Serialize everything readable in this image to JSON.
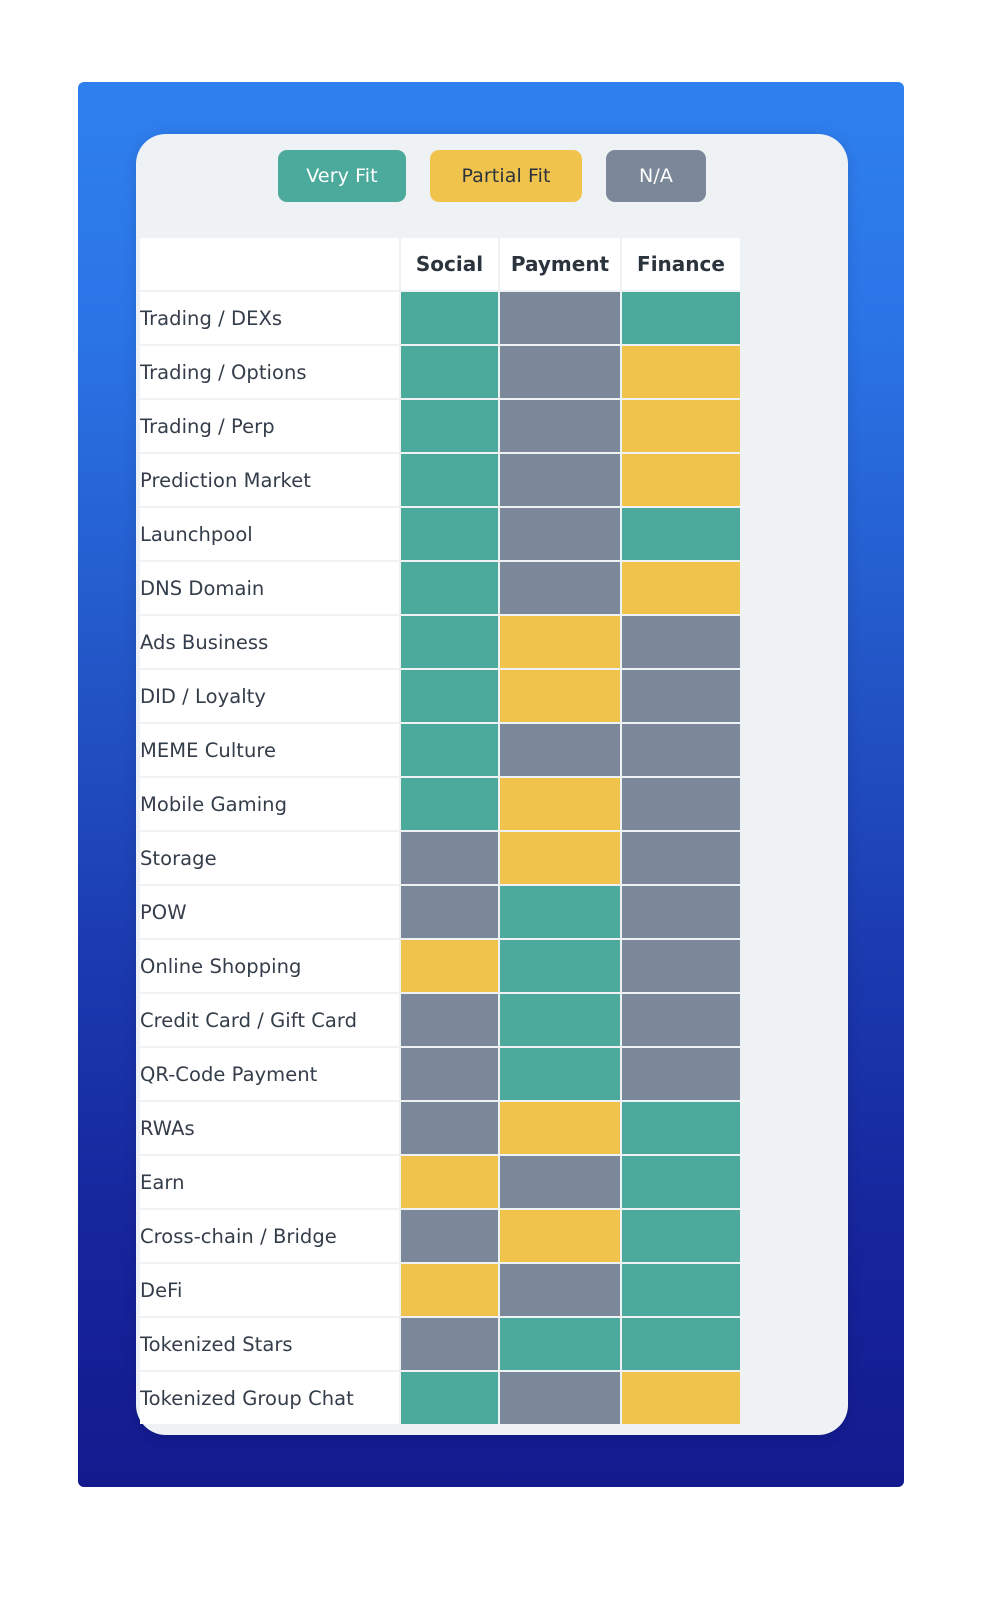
{
  "legend": {
    "items": [
      {
        "key": "very",
        "label": "Very Fit",
        "color": "#4caa9c"
      },
      {
        "key": "partial",
        "label": "Partial Fit",
        "color": "#f0c44c"
      },
      {
        "key": "na",
        "label": "N/A",
        "color": "#7b8899"
      }
    ]
  },
  "theme": {
    "panel_gradient_top": "#2f80ef",
    "panel_gradient_bottom": "#131a8e",
    "card_background": "#eff2f5",
    "cell_border": "#eff2f5",
    "label_background": "#ffffff",
    "text_color": "#343d4a"
  },
  "chart_data": {
    "type": "heatmap",
    "title": "",
    "xlabel": "",
    "ylabel": "",
    "legend_position": "top",
    "value_scale": [
      {
        "value": "very",
        "label": "Very Fit",
        "color": "#4caa9c"
      },
      {
        "value": "partial",
        "label": "Partial Fit",
        "color": "#f0c44c"
      },
      {
        "value": "na",
        "label": "N/A",
        "color": "#7b8899"
      }
    ],
    "columns": [
      "",
      "Social",
      "Payment",
      "Finance"
    ],
    "categories": [
      "Trading / DEXs",
      "Trading / Options",
      "Trading / Perp",
      "Prediction Market",
      "Launchpool",
      "DNS Domain",
      "Ads Business",
      "DID / Loyalty",
      "MEME Culture",
      "Mobile Gaming",
      "Storage",
      "POW",
      "Online Shopping",
      "Credit Card / Gift Card",
      "QR-Code Payment",
      "RWAs",
      "Earn",
      "Cross-chain / Bridge",
      "DeFi",
      "Tokenized Stars",
      "Tokenized Group Chat"
    ],
    "series": [
      {
        "name": "Social",
        "values": [
          "very",
          "very",
          "very",
          "very",
          "very",
          "very",
          "very",
          "very",
          "very",
          "very",
          "na",
          "na",
          "partial",
          "na",
          "na",
          "na",
          "partial",
          "na",
          "partial",
          "na",
          "very"
        ]
      },
      {
        "name": "Payment",
        "values": [
          "na",
          "na",
          "na",
          "na",
          "na",
          "na",
          "partial",
          "partial",
          "na",
          "partial",
          "partial",
          "very",
          "very",
          "very",
          "very",
          "partial",
          "na",
          "partial",
          "na",
          "very",
          "na"
        ]
      },
      {
        "name": "Finance",
        "values": [
          "very",
          "partial",
          "partial",
          "partial",
          "very",
          "partial",
          "na",
          "na",
          "na",
          "na",
          "na",
          "na",
          "na",
          "na",
          "na",
          "very",
          "very",
          "very",
          "very",
          "very",
          "partial"
        ]
      }
    ],
    "rows": [
      {
        "label": "Trading / DEXs",
        "cells": [
          "very",
          "na",
          "very"
        ]
      },
      {
        "label": "Trading / Options",
        "cells": [
          "very",
          "na",
          "partial"
        ]
      },
      {
        "label": "Trading / Perp",
        "cells": [
          "very",
          "na",
          "partial"
        ]
      },
      {
        "label": "Prediction Market",
        "cells": [
          "very",
          "na",
          "partial"
        ]
      },
      {
        "label": "Launchpool",
        "cells": [
          "very",
          "na",
          "very"
        ]
      },
      {
        "label": "DNS Domain",
        "cells": [
          "very",
          "na",
          "partial"
        ]
      },
      {
        "label": "Ads Business",
        "cells": [
          "very",
          "partial",
          "na"
        ]
      },
      {
        "label": "DID / Loyalty",
        "cells": [
          "very",
          "partial",
          "na"
        ]
      },
      {
        "label": "MEME Culture",
        "cells": [
          "very",
          "na",
          "na"
        ]
      },
      {
        "label": "Mobile Gaming",
        "cells": [
          "very",
          "partial",
          "na"
        ]
      },
      {
        "label": "Storage",
        "cells": [
          "na",
          "partial",
          "na"
        ]
      },
      {
        "label": "POW",
        "cells": [
          "na",
          "very",
          "na"
        ]
      },
      {
        "label": "Online Shopping",
        "cells": [
          "partial",
          "very",
          "na"
        ]
      },
      {
        "label": "Credit Card / Gift Card",
        "cells": [
          "na",
          "very",
          "na"
        ]
      },
      {
        "label": "QR-Code Payment",
        "cells": [
          "na",
          "very",
          "na"
        ]
      },
      {
        "label": "RWAs",
        "cells": [
          "na",
          "partial",
          "very"
        ]
      },
      {
        "label": "Earn",
        "cells": [
          "partial",
          "na",
          "very"
        ]
      },
      {
        "label": "Cross-chain / Bridge",
        "cells": [
          "na",
          "partial",
          "very"
        ]
      },
      {
        "label": "DeFi",
        "cells": [
          "partial",
          "na",
          "very"
        ]
      },
      {
        "label": "Tokenized Stars",
        "cells": [
          "na",
          "very",
          "very"
        ]
      },
      {
        "label": "Tokenized Group Chat",
        "cells": [
          "very",
          "na",
          "partial"
        ]
      }
    ]
  }
}
